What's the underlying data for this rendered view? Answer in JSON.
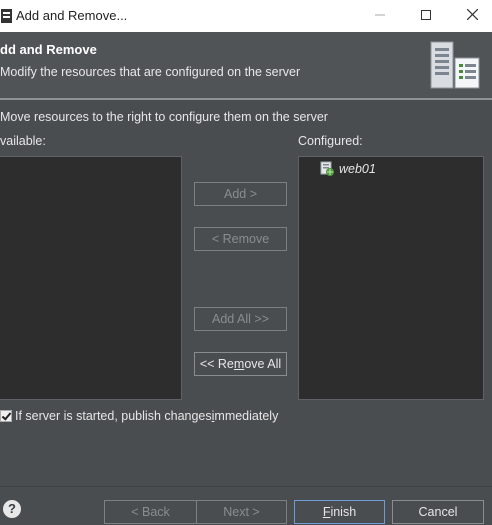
{
  "window": {
    "title": "Add and Remove..."
  },
  "header": {
    "title": "dd and Remove",
    "description": "Modify the resources that are configured on the server"
  },
  "instruction": "Move resources to the right to configure them on the server",
  "available": {
    "label": "vailable:",
    "items": []
  },
  "configured": {
    "label": "Configured:",
    "items": [
      {
        "label": "web01"
      }
    ]
  },
  "buttons": {
    "add": "Add >",
    "remove": "< Remove",
    "add_all": "Add All >>",
    "remove_all_pre": "<< Re",
    "remove_all_mnem": "m",
    "remove_all_post": "ove All"
  },
  "publish": {
    "checked": true,
    "label_pre": "If server is started, publish changes ",
    "label_mnem": "i",
    "label_post": "mmediately"
  },
  "footer": {
    "back": "< Back",
    "next": "Next >",
    "finish_mnem": "F",
    "finish_post": "inish",
    "cancel": "Cancel"
  },
  "colors": {
    "background": "#4a4d50",
    "list": "#2d2d2d",
    "accent": "#6f9bd6"
  },
  "icons": [
    "app-icon",
    "minimize-icon",
    "maximize-icon",
    "close-icon",
    "server-icon",
    "web-module-icon",
    "help-icon"
  ]
}
